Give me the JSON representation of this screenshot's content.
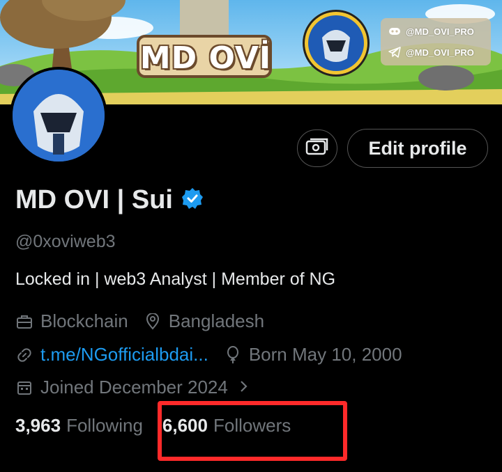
{
  "banner": {
    "sign_text": "MD OVİ",
    "social_handles": [
      "@MD_OVI_PRO",
      "@MD_OVI_PRO"
    ]
  },
  "actions": {
    "edit_profile": "Edit profile"
  },
  "profile": {
    "name": "MD OVI | Sui",
    "verified": true,
    "handle": "@0xoviweb3",
    "bio": "Locked in | web3 Analyst | Member of NG",
    "category": "Blockchain",
    "location": "Bangladesh",
    "link": "t.me/NGofficialbdai...",
    "birthday": "Born May 10, 2000",
    "joined": "Joined December 2024"
  },
  "stats": {
    "following_count": "3,963",
    "following_label": "Following",
    "followers_count": "6,600",
    "followers_label": "Followers"
  },
  "colors": {
    "background": "#000000",
    "primary_text": "#e7e9ea",
    "secondary_text": "#71767b",
    "link": "#1d9bf0",
    "highlight": "#ff2a2a"
  }
}
